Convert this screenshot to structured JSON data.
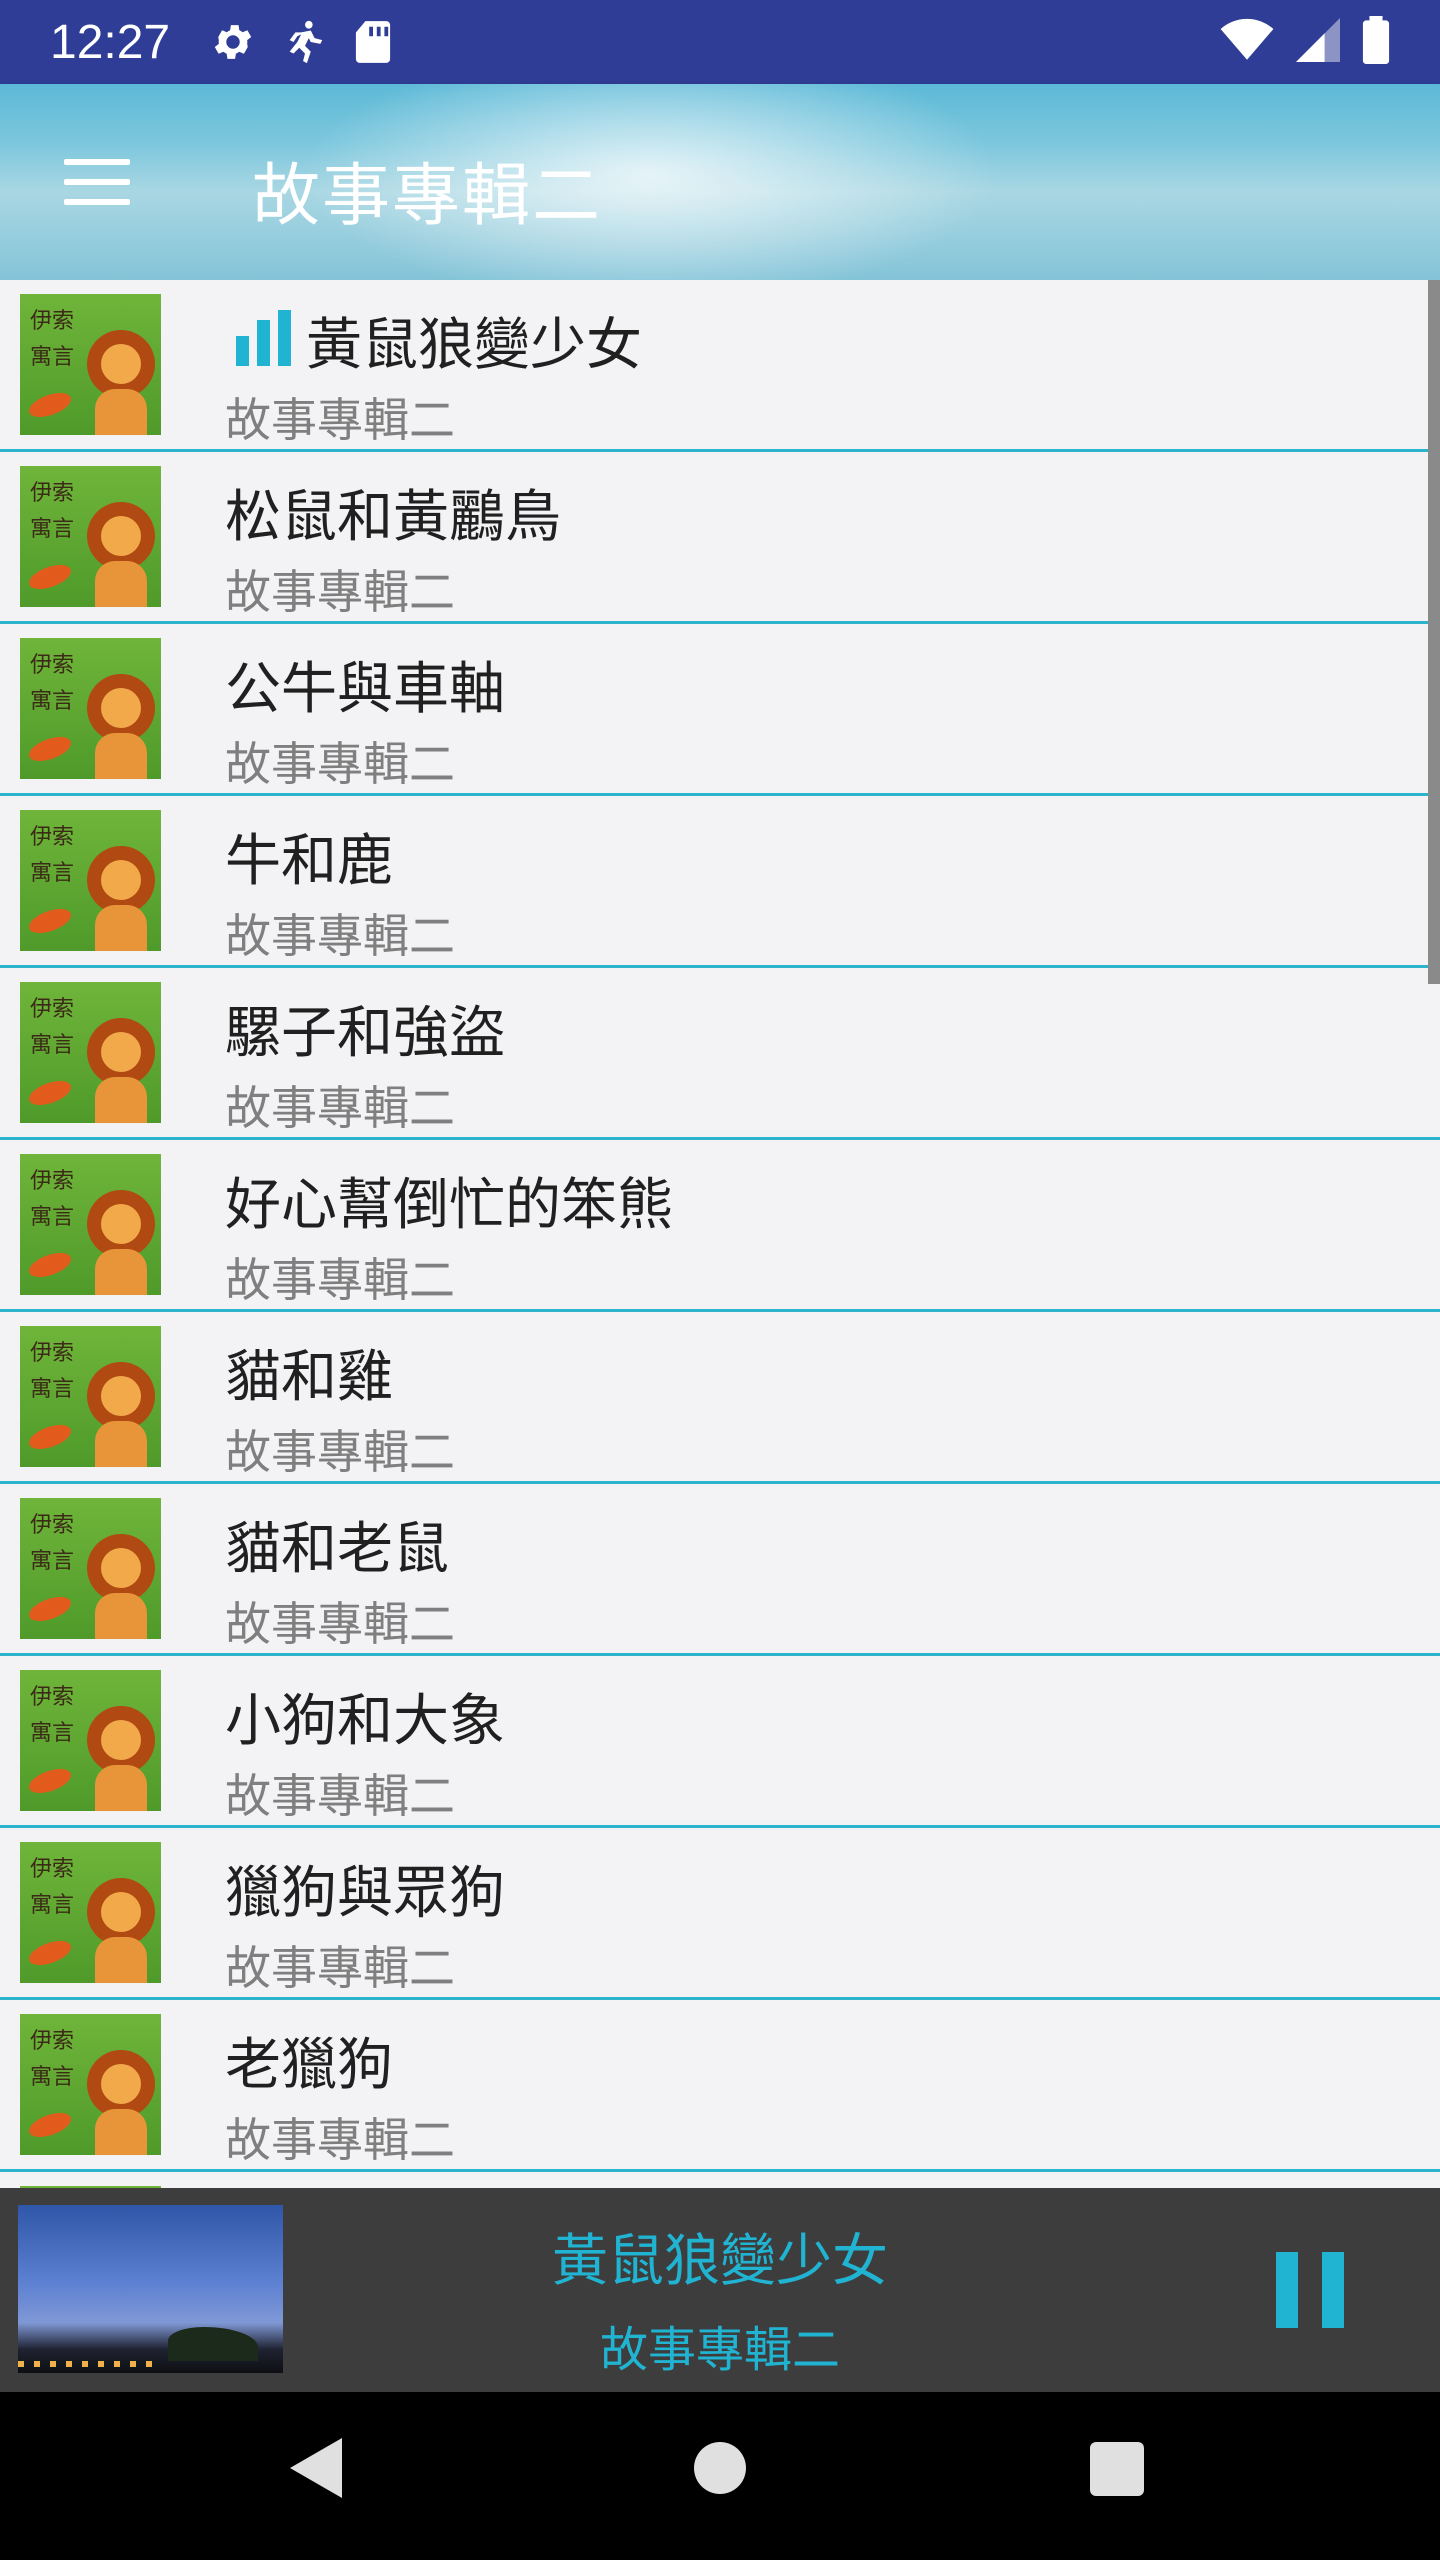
{
  "status_bar": {
    "time": "12:27",
    "icons_left": [
      "gear-icon",
      "running-figure-icon",
      "sd-card-icon"
    ],
    "icons_right": [
      "wifi-icon",
      "cell-signal-icon",
      "battery-icon"
    ]
  },
  "app_bar": {
    "title": "故事專輯二",
    "menu_icon": "hamburger-menu-icon"
  },
  "list": {
    "items": [
      {
        "title": "黃鼠狼變少女",
        "subtitle": "故事專輯二",
        "playing": true
      },
      {
        "title": "松鼠和黃鸝鳥",
        "subtitle": "故事專輯二",
        "playing": false
      },
      {
        "title": "公牛與車軸",
        "subtitle": "故事專輯二",
        "playing": false
      },
      {
        "title": "牛和鹿",
        "subtitle": "故事專輯二",
        "playing": false
      },
      {
        "title": "騾子和強盜",
        "subtitle": "故事專輯二",
        "playing": false
      },
      {
        "title": "好心幫倒忙的笨熊",
        "subtitle": "故事專輯二",
        "playing": false
      },
      {
        "title": "貓和雞",
        "subtitle": "故事專輯二",
        "playing": false
      },
      {
        "title": "貓和老鼠",
        "subtitle": "故事專輯二",
        "playing": false
      },
      {
        "title": "小狗和大象",
        "subtitle": "故事專輯二",
        "playing": false
      },
      {
        "title": "獵狗與眾狗",
        "subtitle": "故事專輯二",
        "playing": false
      },
      {
        "title": "老獵狗",
        "subtitle": "故事專輯二",
        "playing": false
      }
    ],
    "thumbnail_text": [
      "伊索",
      "寓言"
    ]
  },
  "player": {
    "title": "黃鼠狼變少女",
    "subtitle": "故事專輯二",
    "control_icon": "pause-icon"
  },
  "nav_bar": {
    "icons": [
      "back-icon",
      "home-icon",
      "recents-icon"
    ]
  },
  "colors": {
    "accent": "#21b4d2",
    "status_bar": "#2f3d96",
    "player_bg": "#3d3d3d",
    "divider": "#2bb4cc"
  }
}
